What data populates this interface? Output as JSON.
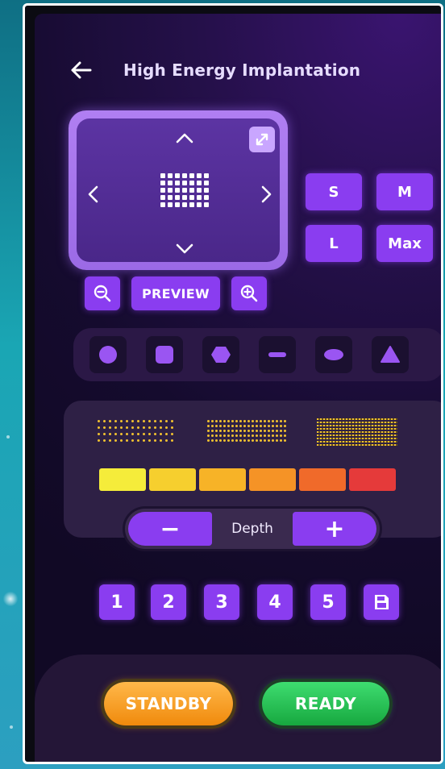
{
  "header": {
    "back_icon": "arrow-left-icon",
    "title": "High Energy Implantation"
  },
  "preview": {
    "arrows": [
      "chevron-up-icon",
      "chevron-down-icon",
      "chevron-left-icon",
      "chevron-right-icon"
    ],
    "expand_icon": "expand-icon"
  },
  "sizes": [
    "S",
    "M",
    "L",
    "Max"
  ],
  "zoom": {
    "zoom_out_icon": "zoom-out-icon",
    "preview_label": "PREVIEW",
    "zoom_in_icon": "zoom-in-icon"
  },
  "shapes": [
    "circle",
    "square",
    "hexagon",
    "line",
    "ellipse",
    "triangle"
  ],
  "density_levels": [
    "low",
    "medium",
    "high"
  ],
  "energy_colors": [
    "#f5ec3a",
    "#f6cf2e",
    "#f7b327",
    "#f59326",
    "#f06a2a",
    "#e53a3a"
  ],
  "depth": {
    "minus": "−",
    "label": "Depth",
    "plus": "+"
  },
  "presets": [
    "1",
    "2",
    "3",
    "4",
    "5"
  ],
  "save_icon": "save-icon",
  "footer": {
    "standby": "STANDBY",
    "ready": "READY"
  },
  "colors": {
    "accent": "#8a3df0",
    "background": "#1a0d33",
    "standby": "#f39312",
    "ready": "#22c24f"
  }
}
